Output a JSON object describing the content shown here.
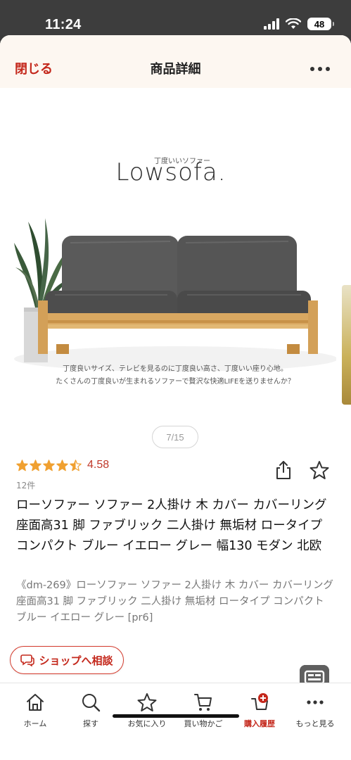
{
  "status_bar": {
    "time": "11:24",
    "battery": "48"
  },
  "header": {
    "close_label": "閉じる",
    "title": "商品詳細"
  },
  "gallery": {
    "brand_small": "丁度いいソファー",
    "brand_title": "Lowsofa.",
    "description_lines": [
      "丁度良いサイズ、テレビを見るのに丁度良い高さ、丁度いい座り心地。",
      "たくさんの丁度良いが生まれるソファーで贅沢な快適LIFEを送りませんか？"
    ],
    "counter": "7/15"
  },
  "product": {
    "rating": "4.58",
    "rating_stars": 4.5,
    "review_count": "12件",
    "title": "ローソファー ソファー 2人掛け 木 カバー カバーリング 座面高31 脚 ファブリック 二人掛け 無垢材 ロータイプ コンパクト ブルー イエロー グレー 幅130 モダン 北欧",
    "subtitle": "《dm-269》ローソファー ソファー 2人掛け 木 カバー カバーリング 座面高31 脚 ファブリック 二人掛け 無垢材 ロータイプ コンパクト ブルー イエロー グレー [pr6]"
  },
  "consult_button": {
    "label": "ショップへ相談"
  },
  "bottom_nav": {
    "items": [
      {
        "label": "ホーム",
        "icon": "home-icon"
      },
      {
        "label": "探す",
        "icon": "search-icon"
      },
      {
        "label": "お気に入り",
        "icon": "star-icon"
      },
      {
        "label": "買い物かご",
        "icon": "cart-icon"
      },
      {
        "label": "購入履歴",
        "icon": "purchase-history-icon"
      },
      {
        "label": "もっと見る",
        "icon": "more-icon"
      }
    ],
    "active_index": 4
  },
  "colors": {
    "accent": "#c4281c",
    "star": "#f0a030",
    "header_bg": "#fdf7f1"
  }
}
